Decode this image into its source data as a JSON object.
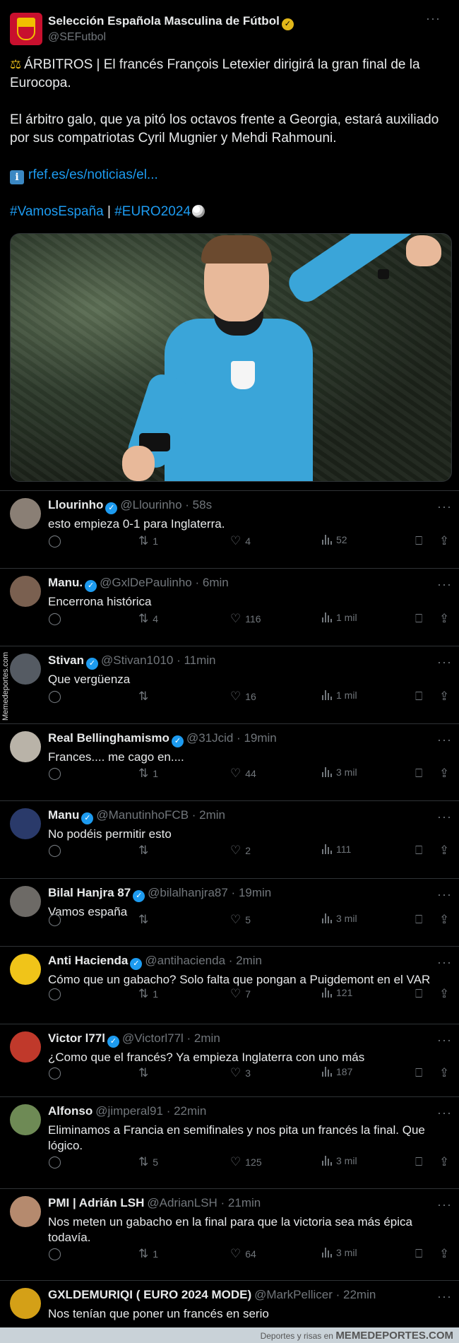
{
  "main_tweet": {
    "name": "Selección Española Masculina de Fútbol",
    "handle": "@SEFutbol",
    "verified_icon": "gold-check-badge",
    "line1": "ÁRBITROS | El francés François Letexier dirigirá la gran final de la Eurocopa.",
    "line2": "El árbitro galo, que ya pitó los octavos frente a Georgia, estará auxiliado por sus compatriotas Cyril Mugnier y Mehdi Rahmouni.",
    "link": "rfef.es/es/noticias/el...",
    "hashtag1": "#VamosEspaña",
    "separator": "|",
    "hashtag2": "#EURO2024",
    "more": "···"
  },
  "replies": [
    {
      "name": "Llourinho",
      "meta": "@Llourinho · 58s",
      "text": "esto empieza 0-1 para Inglaterra.",
      "retweets": "1",
      "likes": "4",
      "views": "52",
      "verified": true,
      "avatar_color": "#8a7f75"
    },
    {
      "name": "Manu.",
      "meta": "@GxlDePaulinho · 6min",
      "text": "Encerrona histórica",
      "retweets": "4",
      "likes": "116",
      "views": "1 mil",
      "verified": true,
      "avatar_color": "#7a6050"
    },
    {
      "name": "Stivan",
      "meta": "@Stivan1010 · 11min",
      "text": "Que vergüenza",
      "retweets": "",
      "likes": "16",
      "views": "1 mil",
      "verified": true,
      "avatar_color": "#555b63"
    },
    {
      "name": "Real Bellinghamismo",
      "meta": "@31Jcid · 19min",
      "text": "Frances.... me cago en....",
      "retweets": "1",
      "likes": "44",
      "views": "3 mil",
      "verified": true,
      "avatar_color": "#b9b3a8"
    },
    {
      "name": "Manu",
      "meta": "@ManutinhoFCB · 2min",
      "text": "No podéis permitir esto",
      "retweets": "",
      "likes": "2",
      "views": "111",
      "verified": true,
      "avatar_color": "#2a3a6a"
    },
    {
      "name": "Bilal Hanjra 87",
      "meta": "@bilalhanjra87 · 19min",
      "text": "Vamos españa",
      "retweets": "",
      "likes": "5",
      "views": "3 mil",
      "verified": true,
      "avatar_color": "#6d6a66"
    },
    {
      "name": "Anti Hacienda",
      "meta": "@antihacienda · 2min",
      "text": "Cómo que un gabacho? Solo falta que pongan a Puigdemont en el VAR",
      "retweets": "1",
      "likes": "7",
      "views": "121",
      "verified": true,
      "avatar_color": "#f0c419"
    },
    {
      "name": "Victor l77l",
      "meta": "@Victorl77l · 2min",
      "text": "¿Como que el francés? Ya empieza Inglaterra con uno más",
      "retweets": "",
      "likes": "3",
      "views": "187",
      "verified": true,
      "avatar_color": "#c0392b"
    },
    {
      "name": "Alfonso",
      "meta": "@jimperal91 · 22min",
      "text": "Eliminamos a Francia en semifinales y nos pita un francés la final. Que lógico.",
      "retweets": "5",
      "likes": "125",
      "views": "3 mil",
      "verified": false,
      "avatar_color": "#6e8a55"
    },
    {
      "name": "PMI | Adrián LSH",
      "meta": "@AdrianLSH · 21min",
      "text": "Nos meten un gabacho en la final para que la victoria sea más épica todavía.",
      "retweets": "1",
      "likes": "64",
      "views": "3 mil",
      "verified": false,
      "avatar_color": "#b58a6e"
    },
    {
      "name": "GXLDEMURIQI",
      "name_suffix": "( EURO 2024 MODE)",
      "meta": "@MarkPellicer · 22min",
      "text": "Nos tenían que poner un francés en serio",
      "verified": false,
      "avatar_color": "#d4a017"
    }
  ],
  "watermark_side": "Memedeportes.com",
  "footer": {
    "small": "Deportes y risas en",
    "brand": "MEMEDEPORTES.COM"
  }
}
